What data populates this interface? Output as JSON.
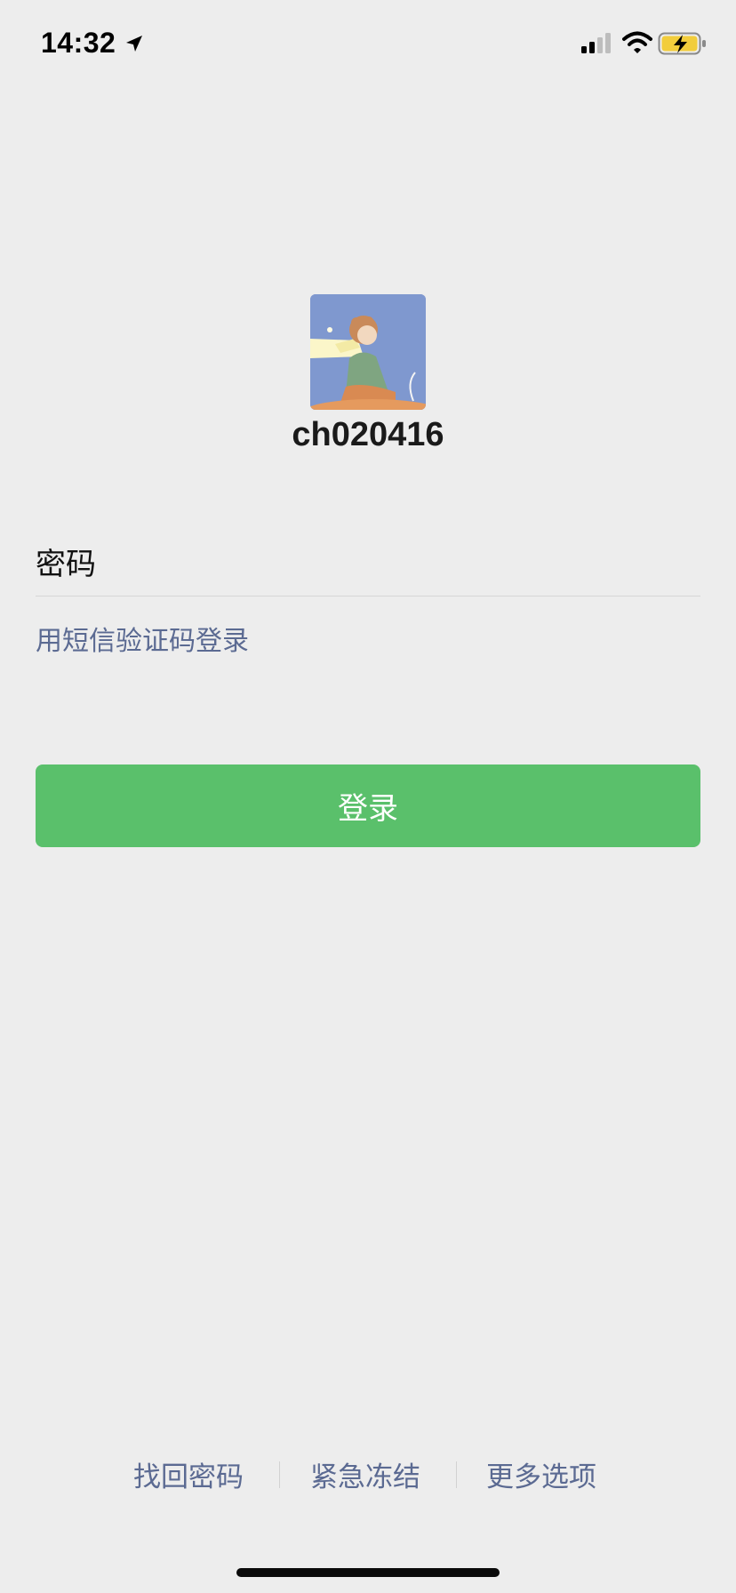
{
  "status_bar": {
    "time": "14:32",
    "icons": [
      "location-arrow-icon",
      "cellular-signal-icon",
      "wifi-icon",
      "battery-charging-icon"
    ]
  },
  "profile": {
    "avatar_icon": "avatar-image",
    "username": "ch020416"
  },
  "password_field": {
    "placeholder": "密码",
    "value": ""
  },
  "sms_login_link": "用短信验证码登录",
  "login_button": "登录",
  "bottom_links": {
    "forgot_password": "找回密码",
    "emergency_freeze": "紧急冻结",
    "more_options": "更多选项"
  },
  "colors": {
    "background": "#ededed",
    "accent_green": "#5ac06b",
    "link_blue": "#5b6a92"
  }
}
